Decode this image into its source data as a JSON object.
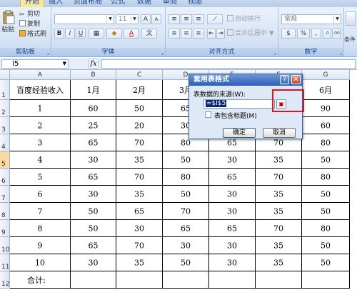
{
  "ribbon": {
    "tabs": [
      "开始",
      "插入",
      "页面布局",
      "公式",
      "数据",
      "审阅",
      "视图"
    ],
    "clipboard": {
      "paste": "粘贴",
      "cut": "剪切",
      "copy": "复制",
      "format_painter": "格式刷",
      "label": "剪贴板"
    },
    "font": {
      "font_size": "11",
      "label": "字体",
      "grow": "A",
      "shrink": "A",
      "bold": "B",
      "italic": "I",
      "underline": "U",
      "color": "A",
      "wen": "文"
    },
    "alignment": {
      "wrap": "自动换行",
      "merge": "合并后居中",
      "label": "对齐方式"
    },
    "number": {
      "format": "常规",
      "currency": "$",
      "percent": "%",
      "comma": ",",
      "label": "数字"
    },
    "extra": {
      "label": "条件"
    }
  },
  "formula_bar": {
    "name_box": "I5",
    "fx": "fx"
  },
  "grid": {
    "columns": [
      "A",
      "B",
      "C",
      "D",
      "E",
      "F",
      "G"
    ],
    "rows": [
      "1",
      "2",
      "3",
      "4",
      "5",
      "6",
      "7",
      "8",
      "9",
      "10",
      "11",
      "12"
    ],
    "cells": [
      [
        "百度经验收入",
        "1月",
        "2月",
        "3月",
        "",
        "",
        "6月"
      ],
      [
        "1",
        "60",
        "50",
        "65",
        "",
        "",
        "90"
      ],
      [
        "2",
        "25",
        "20",
        "30",
        "",
        "",
        "60"
      ],
      [
        "3",
        "65",
        "70",
        "80",
        "65",
        "70",
        "80"
      ],
      [
        "4",
        "30",
        "35",
        "50",
        "30",
        "35",
        "50"
      ],
      [
        "5",
        "65",
        "70",
        "80",
        "65",
        "70",
        "80"
      ],
      [
        "6",
        "30",
        "35",
        "50",
        "30",
        "35",
        "50"
      ],
      [
        "7",
        "50",
        "65",
        "70",
        "30",
        "35",
        "50"
      ],
      [
        "8",
        "50",
        "30",
        "65",
        "65",
        "70",
        "80"
      ],
      [
        "9",
        "65",
        "70",
        "30",
        "30",
        "35",
        "50"
      ],
      [
        "10",
        "30",
        "35",
        "50",
        "30",
        "35",
        "50"
      ],
      [
        "合计:",
        "",
        "",
        "",
        "",
        "",
        ""
      ]
    ]
  },
  "dialog": {
    "title": "套用表格式",
    "help": "?",
    "close": "✕",
    "source_label": "表数据的来源(W):",
    "source_value": "=$I$5",
    "has_headers_label": "表包含标题(M)",
    "has_headers_checked": false,
    "ok": "确定",
    "cancel": "取消"
  }
}
